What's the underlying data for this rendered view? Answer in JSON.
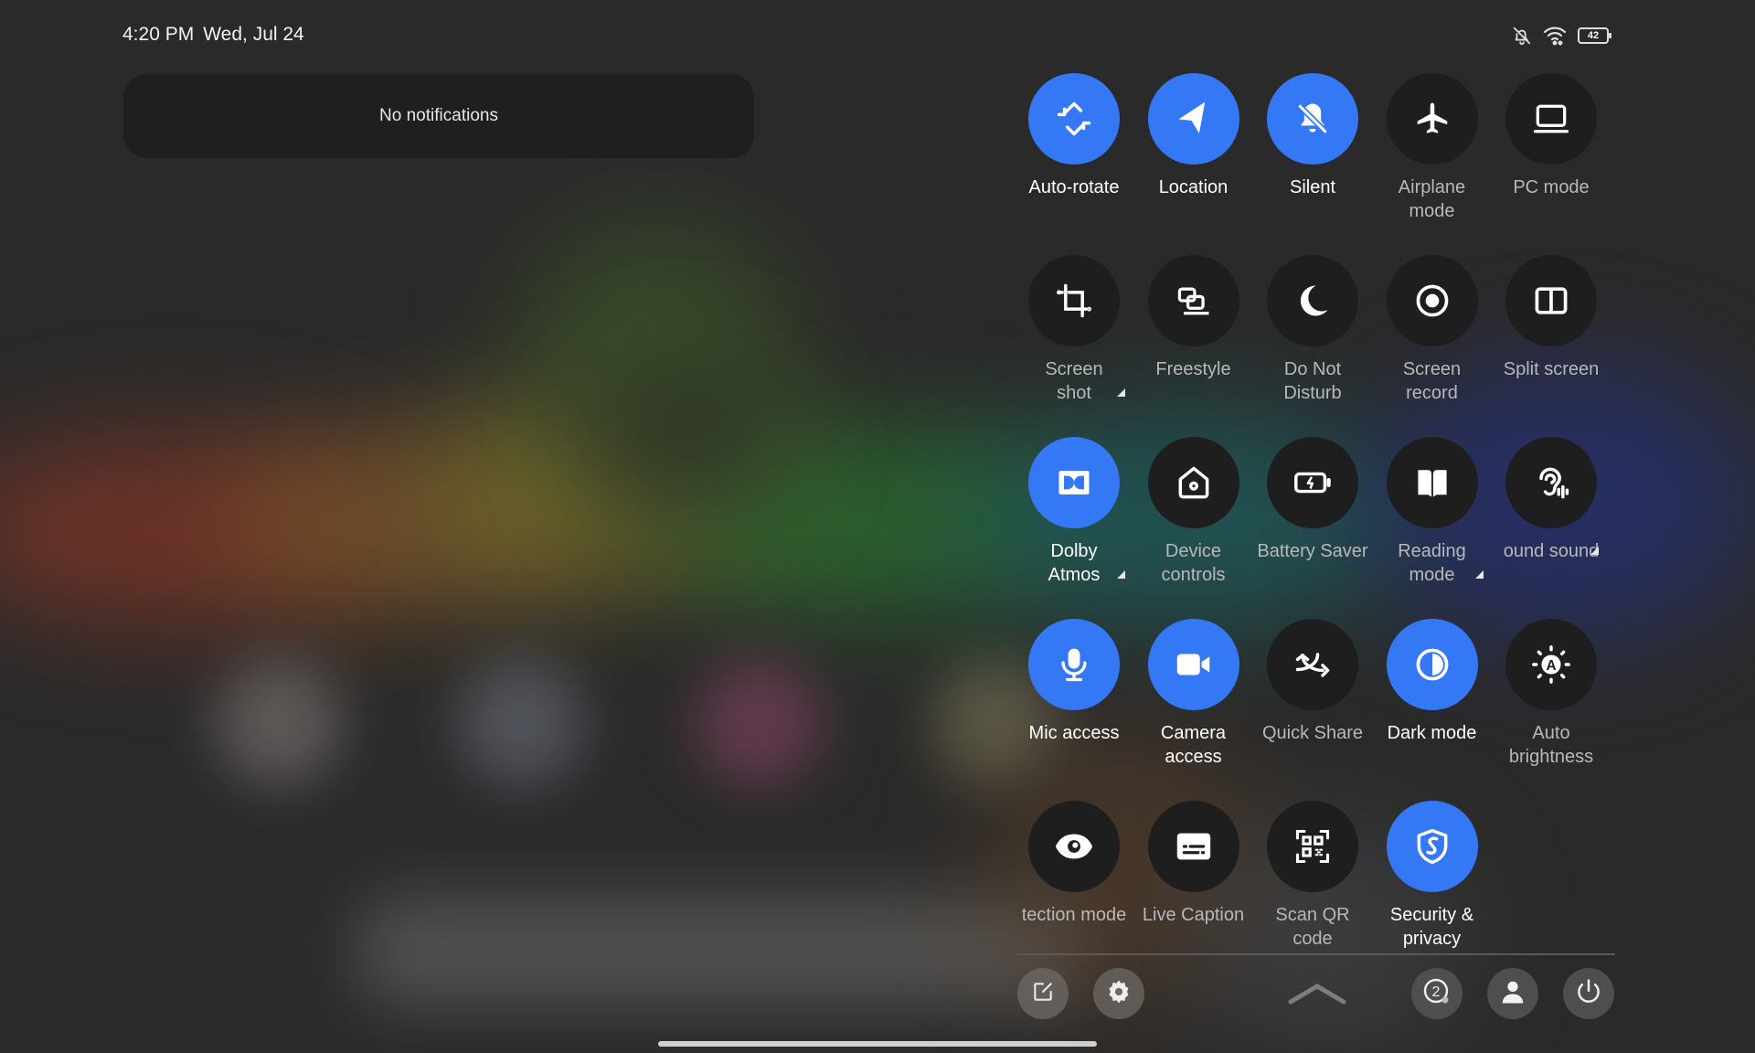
{
  "status_bar": {
    "time": "4:20 PM",
    "date": "Wed, Jul 24",
    "icons": [
      "bell-off-icon",
      "wifi-icon",
      "battery-icon"
    ],
    "battery_level": "42"
  },
  "notifications": {
    "empty_text": "No notifications"
  },
  "quick_settings": {
    "accent_color": "#3478f6",
    "tiles": [
      {
        "label": "Auto-rotate",
        "icon": "auto-rotate-icon",
        "active": true
      },
      {
        "label": "Location",
        "icon": "location-icon",
        "active": true
      },
      {
        "label": "Silent",
        "icon": "bell-off-icon",
        "active": true
      },
      {
        "label": "Airplane\nmode",
        "icon": "airplane-icon",
        "active": false
      },
      {
        "label": "PC mode",
        "icon": "laptop-icon",
        "active": false
      },
      {
        "label": "Screen\nshot",
        "icon": "crop-icon",
        "active": false,
        "has_more": true
      },
      {
        "label": "Freestyle",
        "icon": "freestyle-icon",
        "active": false
      },
      {
        "label": "Do Not\nDisturb",
        "icon": "moon-icon",
        "active": false
      },
      {
        "label": "Screen\nrecord",
        "icon": "record-icon",
        "active": false
      },
      {
        "label": "Split screen",
        "icon": "split-screen-icon",
        "active": false
      },
      {
        "label": "Dolby\nAtmos",
        "icon": "dolby-icon",
        "active": true,
        "has_more": true
      },
      {
        "label": "Device\ncontrols",
        "icon": "home-icon",
        "active": false
      },
      {
        "label": "Battery Saver",
        "icon": "battery-saver-icon",
        "active": false
      },
      {
        "label": "Reading\nmode",
        "icon": "book-icon",
        "active": false,
        "has_more": true
      },
      {
        "label": "ound sound",
        "icon": "ear-icon",
        "active": false,
        "has_more": true
      },
      {
        "label": "Mic access",
        "icon": "mic-icon",
        "active": true
      },
      {
        "label": "Camera\naccess",
        "icon": "camera-icon",
        "active": true
      },
      {
        "label": "Quick Share",
        "icon": "quick-share-icon",
        "active": false
      },
      {
        "label": "Dark mode",
        "icon": "dark-mode-icon",
        "active": true
      },
      {
        "label": "Auto\nbrightness",
        "icon": "auto-brightness-icon",
        "active": false
      },
      {
        "label": "tection mode",
        "icon": "eye-icon",
        "active": false
      },
      {
        "label": "Live Caption",
        "icon": "caption-icon",
        "active": false
      },
      {
        "label": "Scan QR\ncode",
        "icon": "qr-icon",
        "active": false
      },
      {
        "label": "Security &\nprivacy",
        "icon": "shield-icon",
        "active": true
      }
    ]
  },
  "bottom_bar": {
    "buttons": [
      {
        "name": "edit",
        "icon": "edit-icon"
      },
      {
        "name": "settings",
        "icon": "gear-icon"
      },
      {
        "name": "collapse",
        "icon": "chevron-up-icon"
      },
      {
        "name": "dual-app",
        "icon": "dual-app-icon"
      },
      {
        "name": "user",
        "icon": "user-icon"
      },
      {
        "name": "power",
        "icon": "power-icon"
      }
    ]
  }
}
